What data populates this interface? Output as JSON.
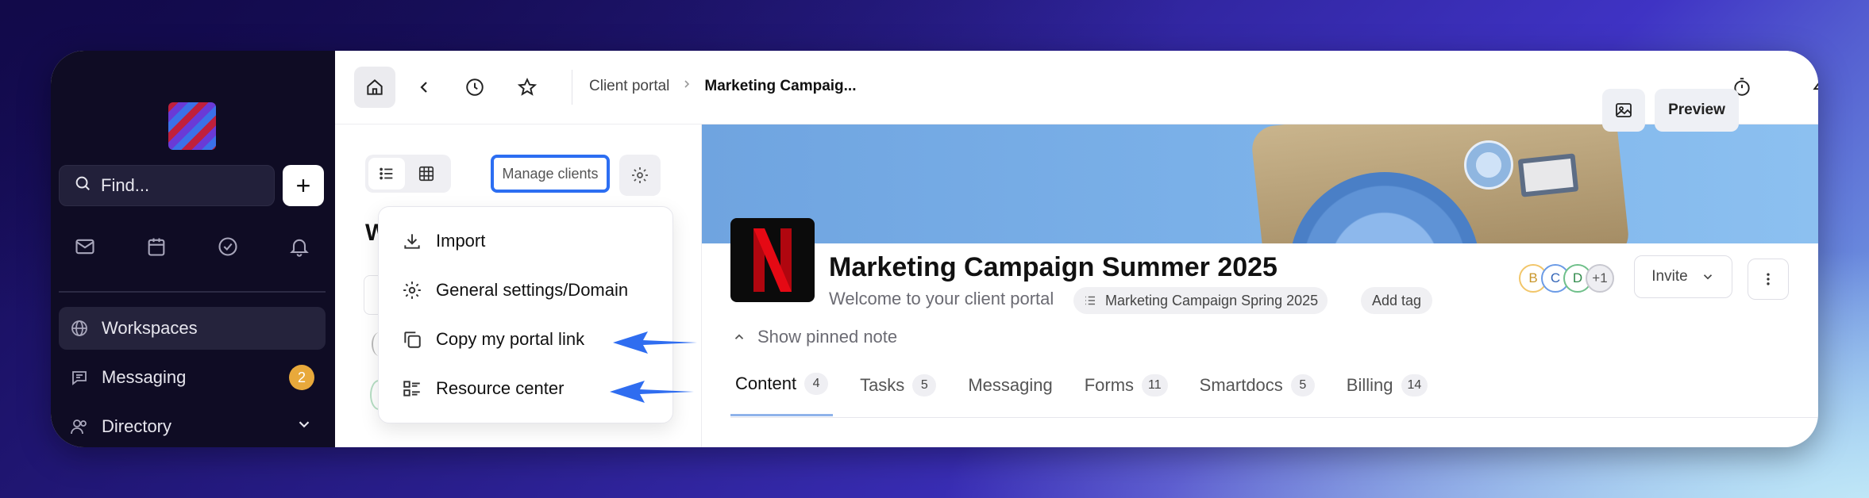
{
  "sidebar": {
    "find_placeholder": "Find...",
    "add_label": "+",
    "nav": [
      {
        "label": "Workspaces"
      },
      {
        "label": "Messaging",
        "badge": "2"
      },
      {
        "label": "Directory"
      }
    ]
  },
  "topbar": {
    "breadcrumb": [
      "Client portal",
      "Marketing Campaig..."
    ]
  },
  "clients_panel": {
    "manage_label": "Manage clients",
    "heading_initial": "W",
    "menu": [
      {
        "icon": "download-icon",
        "label": "Import"
      },
      {
        "icon": "gear-icon",
        "label": "General settings/Domain"
      },
      {
        "icon": "copy-icon",
        "label": "Copy my portal link"
      },
      {
        "icon": "resource-icon",
        "label": "Resource center"
      }
    ]
  },
  "portal": {
    "preview_label": "Preview",
    "title": "Marketing Campaign Summer 2025",
    "welcome": "Welcome to your client portal",
    "tag": "Marketing Campaign Spring 2025",
    "add_tag": "Add tag",
    "avatars": [
      "B",
      "C",
      "D",
      "+1"
    ],
    "invite_label": "Invite",
    "pinned_note": "Show pinned note",
    "tabs": [
      {
        "label": "Content",
        "count": "4"
      },
      {
        "label": "Tasks",
        "count": "5"
      },
      {
        "label": "Messaging",
        "count": ""
      },
      {
        "label": "Forms",
        "count": "11"
      },
      {
        "label": "Smartdocs",
        "count": "5"
      },
      {
        "label": "Billing",
        "count": "14"
      }
    ]
  },
  "colors": {
    "accent_blue": "#2c6ef2",
    "badge_orange": "#e8a93b",
    "sidebar_bg": "#0f0c24"
  }
}
